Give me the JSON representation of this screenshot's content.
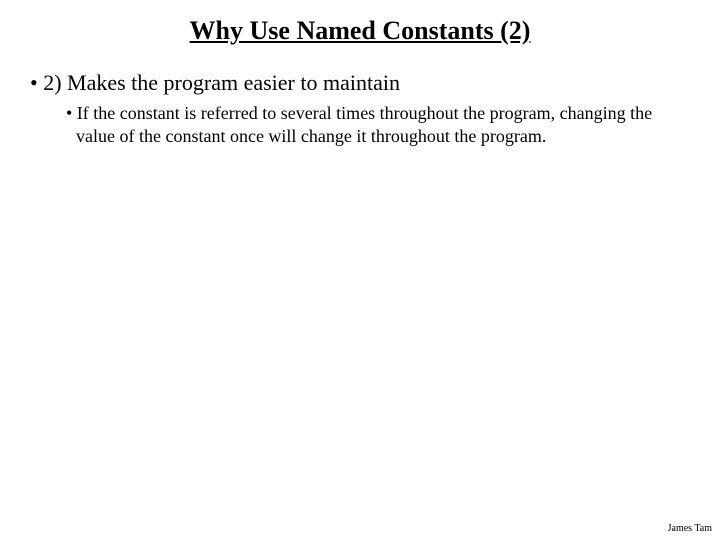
{
  "title": "Why Use Named Constants (2)",
  "bullets": {
    "l1": "• 2) Makes the program easier to maintain",
    "l2": "• If the constant is referred to several times throughout the program, changing the value of the constant once will change it throughout the program."
  },
  "footer": "James Tam"
}
